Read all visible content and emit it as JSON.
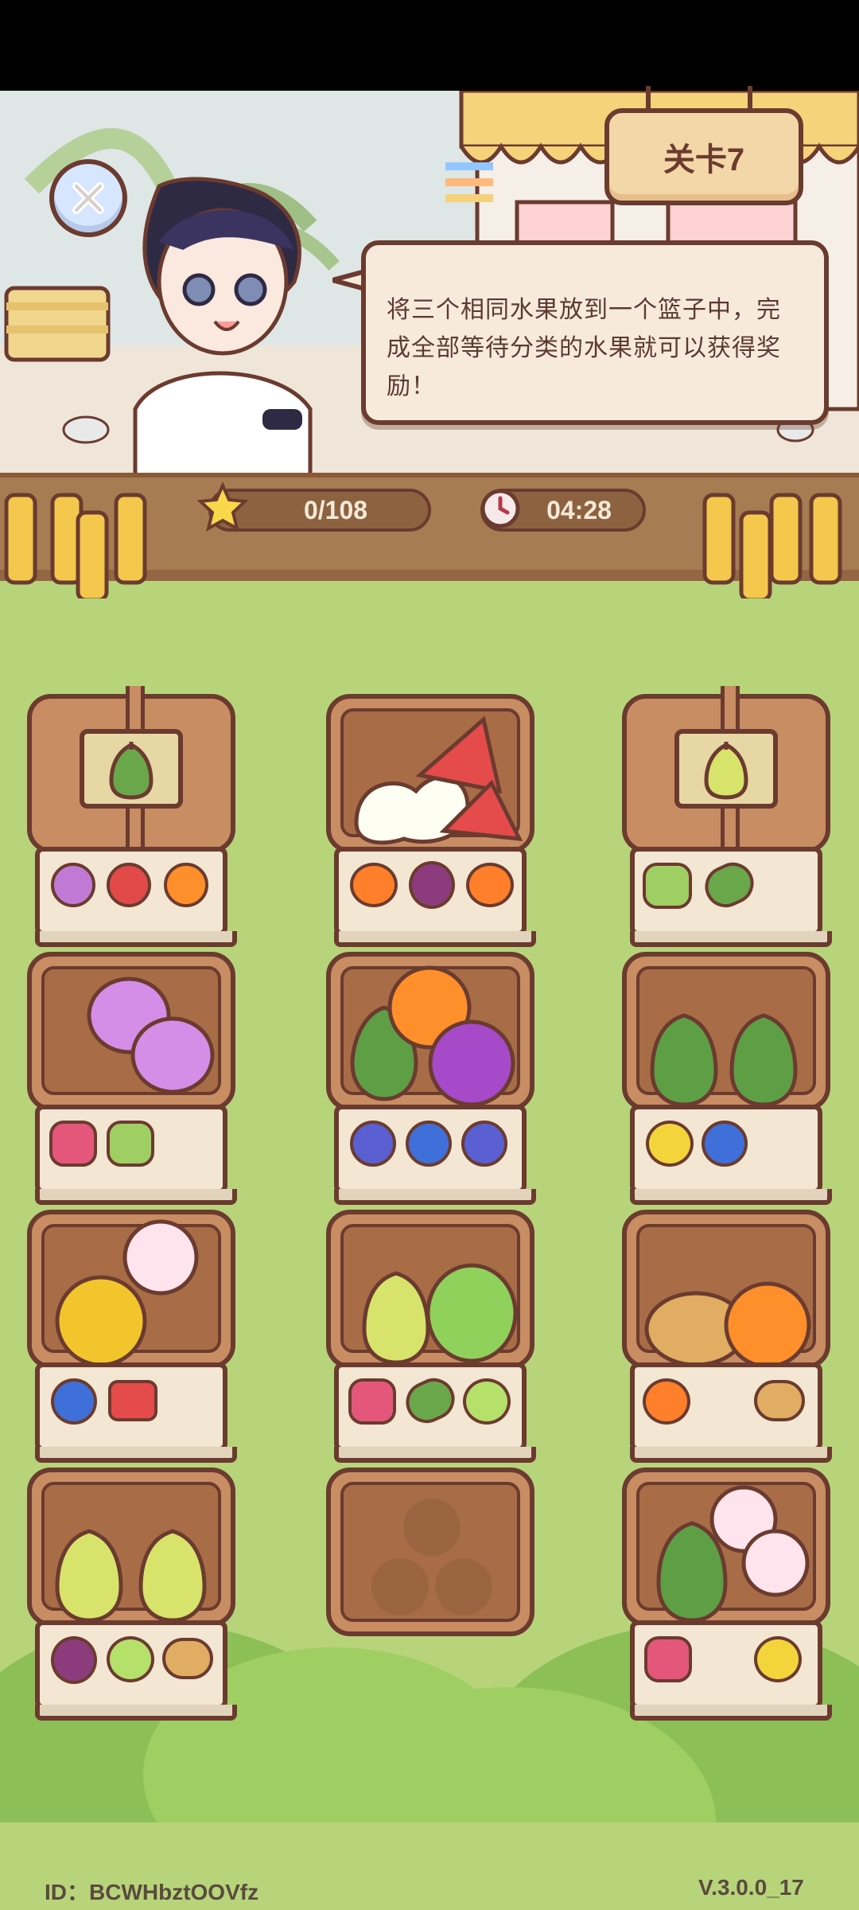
{
  "header": {
    "level_label": "关卡7",
    "dialog_text": "将三个相同水果放到一个篮子中，完成全部等待分类的水果就可以获得奖励！"
  },
  "status": {
    "score": "0/108",
    "timer": "04:28"
  },
  "icons": {
    "close": "close-icon",
    "star": "star-icon",
    "clock": "clock-icon"
  },
  "baskets": [
    {
      "id": "b1",
      "state": "covered",
      "cover": "pear-dark",
      "queue": [
        "onion",
        "pomegranate",
        "orange"
      ]
    },
    {
      "id": "b2",
      "state": "open",
      "contents": [
        "cauliflower",
        "watermelon",
        "watermelon"
      ],
      "queue": [
        "persimmon",
        "plum",
        "persimmon"
      ]
    },
    {
      "id": "b3",
      "state": "covered",
      "cover": "pear-yellow",
      "queue": [
        "grapes",
        "peas"
      ]
    },
    {
      "id": "b4",
      "state": "open",
      "contents": [
        "onion",
        "onion"
      ],
      "queue": [
        "raspberry",
        "grapes"
      ]
    },
    {
      "id": "b5",
      "state": "open",
      "contents": [
        "pear-dark",
        "orange",
        "plum"
      ],
      "queue": [
        "blackberry",
        "blueberry",
        "blackberry"
      ]
    },
    {
      "id": "b6",
      "state": "open",
      "contents": [
        "pear-dark",
        "pear-dark"
      ],
      "queue": [
        "apple-yellow",
        "blueberry"
      ]
    },
    {
      "id": "b7",
      "state": "open",
      "contents": [
        "apple-yellow",
        "peach"
      ],
      "queue": [
        "blueberry",
        "watermelon"
      ]
    },
    {
      "id": "b8",
      "state": "open",
      "contents": [
        "pear-yellow",
        "grapes"
      ],
      "queue": [
        "raspberry",
        "peas",
        "melon"
      ]
    },
    {
      "id": "b9",
      "state": "open",
      "contents": [
        "bread",
        "orange"
      ],
      "queue": [
        "persimmon",
        "bread"
      ]
    },
    {
      "id": "b10",
      "state": "open",
      "contents": [
        "pear-yellow",
        "pear-yellow"
      ],
      "queue": [
        "plum",
        "melon",
        "bread"
      ]
    },
    {
      "id": "b11",
      "state": "empty",
      "contents": [],
      "queue": []
    },
    {
      "id": "b12",
      "state": "open",
      "contents": [
        "pear-dark",
        "peach",
        "peach"
      ],
      "queue": [
        "raspberry",
        "apple-yellow"
      ]
    }
  ],
  "footer": {
    "id_text": "ID：BCWHbztOOVfz",
    "version": "V.3.0.0_17"
  },
  "colors": {
    "grass": "#b7d47a",
    "wood": "#c98d63",
    "outline": "#6b3b2f"
  }
}
